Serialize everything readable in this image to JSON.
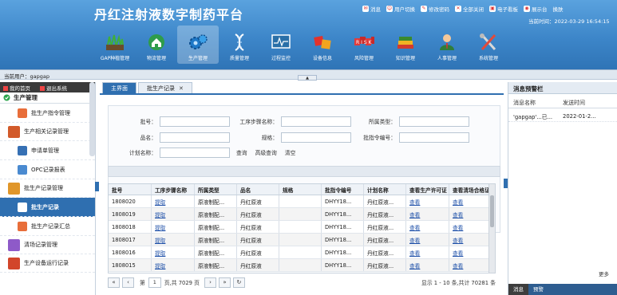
{
  "header": {
    "title": "丹红注射液数字制药平台",
    "top_links": [
      {
        "label": "消息",
        "icon": "message-icon"
      },
      {
        "label": "用户切换",
        "icon": "user-switch-icon"
      },
      {
        "label": "修改密码",
        "icon": "password-icon"
      },
      {
        "label": "全部关闭",
        "icon": "close-all-icon"
      },
      {
        "label": "电子看板",
        "icon": "board-icon"
      },
      {
        "label": "展示台",
        "icon": "display-icon"
      },
      {
        "label": "换肤",
        "icon": "skin-icon"
      }
    ],
    "now_label": "当前时间：",
    "now_value": "2022-03-29 16:54:15",
    "modules": [
      {
        "label": "GAP种植管理",
        "icon": "grass-icon"
      },
      {
        "label": "物流管理",
        "icon": "house-icon"
      },
      {
        "label": "生产管理",
        "icon": "gears-icon"
      },
      {
        "label": "质量管理",
        "icon": "dna-icon"
      },
      {
        "label": "过程监控",
        "icon": "monitor-icon"
      },
      {
        "label": "设备信息",
        "icon": "cubes-icon"
      },
      {
        "label": "风险管理",
        "icon": "risk-icon"
      },
      {
        "label": "知识管理",
        "icon": "books-icon"
      },
      {
        "label": "人事管理",
        "icon": "person-icon"
      },
      {
        "label": "系统管理",
        "icon": "tools-icon"
      }
    ],
    "active_module": "生产管理"
  },
  "userbar": {
    "label": "当前用户：",
    "user": "gapgap"
  },
  "sidebar": {
    "home": "我的首页",
    "logout": "退出系统",
    "group": "生产管理",
    "items": [
      {
        "label": "批生产指令管理",
        "level": 1,
        "icon": "document-icon"
      },
      {
        "label": "生产相关记录管理",
        "level": 1,
        "icon": "record-icon"
      },
      {
        "label": "申请单管理",
        "level": 2,
        "icon": "form-icon"
      },
      {
        "label": "OPC记录报表",
        "level": 2,
        "icon": "report-icon"
      },
      {
        "label": "批生产记录管理",
        "level": 1,
        "icon": "batch-icon"
      },
      {
        "label": "批生产记录",
        "level": 2,
        "icon": "list-icon",
        "active": true
      },
      {
        "label": "批生产记录汇总",
        "level": 2,
        "icon": "summary-icon"
      },
      {
        "label": "清场记录管理",
        "level": 1,
        "icon": "clean-icon"
      },
      {
        "label": "生产设备运行记录",
        "level": 1,
        "icon": "equipment-icon"
      }
    ]
  },
  "tabs": [
    {
      "label": "主界面",
      "active": true
    },
    {
      "label": "批生产记录",
      "active": false,
      "closable": true
    }
  ],
  "search_form": {
    "batch_label": "批号：",
    "process_label": "工序步骤名称：",
    "type_label": "所属类型：",
    "name_label": "品名：",
    "spec_label": "规格：",
    "order_label": "批指令编号：",
    "plan_label": "计划名称：",
    "batch_value": "",
    "process_value": "",
    "type_value": "",
    "name_value": "",
    "spec_value": "",
    "order_value": "",
    "plan_value": "",
    "search_button": "查询",
    "advanced_button": "高级查询",
    "clear_button": "清空"
  },
  "grid": {
    "columns": [
      "批号",
      "工序步骤名称",
      "所属类型",
      "品名",
      "规格",
      "批指令编号",
      "计划名称",
      "查看生产许可证",
      "查看清场合格证"
    ],
    "rows": [
      [
        "1808020",
        "提取",
        "原液制配...",
        "丹红原液",
        "",
        "DHYY18...",
        "丹红原液...",
        "查看",
        "查看"
      ],
      [
        "1808019",
        "提取",
        "原液制配...",
        "丹红原液",
        "",
        "DHYY18...",
        "丹红原液...",
        "查看",
        "查看"
      ],
      [
        "1808018",
        "提取",
        "原液制配...",
        "丹红原液",
        "",
        "DHYY18...",
        "丹红原液...",
        "查看",
        "查看"
      ],
      [
        "1808017",
        "提取",
        "原液制配...",
        "丹红原液",
        "",
        "DHYY18...",
        "丹红原液...",
        "查看",
        "查看"
      ],
      [
        "1808016",
        "提取",
        "原液制配...",
        "丹红原液",
        "",
        "DHYY18...",
        "丹红原液...",
        "查看",
        "查看"
      ],
      [
        "1808015",
        "提取",
        "原液制配...",
        "丹红原液",
        "",
        "DHYY18...",
        "丹红原液...",
        "查看",
        "查看"
      ]
    ]
  },
  "pager": {
    "first": "«",
    "prev": "‹",
    "page_prefix": "第",
    "page_value": "1",
    "page_suffix": "页,共 7029 页",
    "next": "›",
    "last": "»",
    "refresh": "↻",
    "info": "显示 1 - 10 条,共计 70281 条"
  },
  "right_panel": {
    "title": "消息预警栏",
    "col_name": "消息名称",
    "col_time": "发送时间",
    "rows": [
      {
        "name": "'gapgap'...已...",
        "time": "2022-01-2..."
      }
    ],
    "more": "更多",
    "bottom_tabs": [
      "消息",
      "预警"
    ]
  },
  "collapse_label": "▲"
}
